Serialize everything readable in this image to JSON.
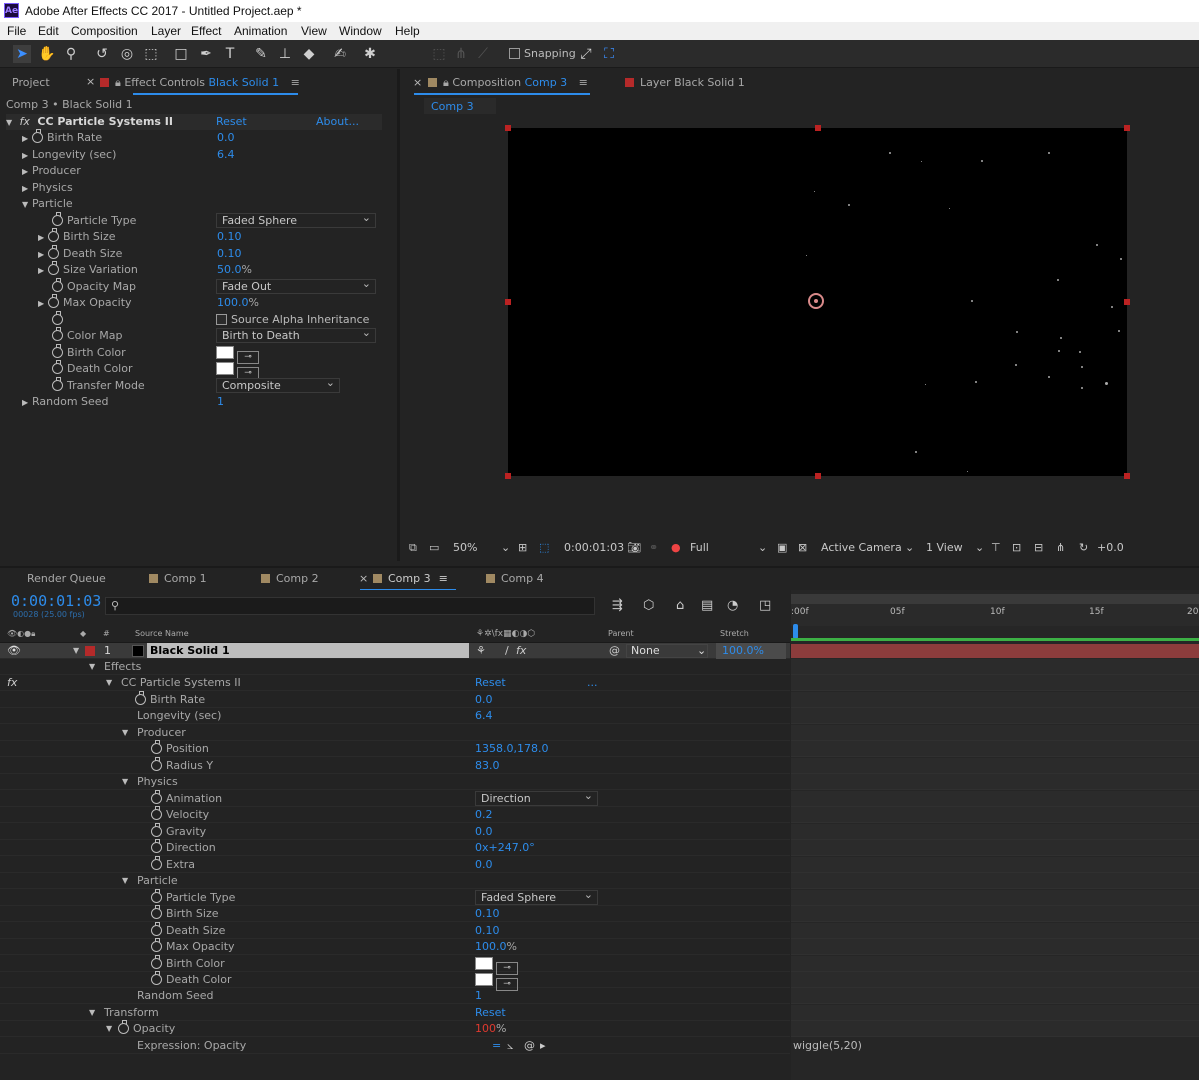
{
  "window": {
    "logo": "Ae",
    "title": "Adobe After Effects CC 2017 - Untitled Project.aep *"
  },
  "menu": [
    "File",
    "Edit",
    "Composition",
    "Layer",
    "Effect",
    "Animation",
    "View",
    "Window",
    "Help"
  ],
  "toolbar": {
    "snapping_label": "Snapping"
  },
  "left_panel": {
    "tab_project": "Project",
    "tab_effect_controls_prefix": "Effect Controls",
    "tab_effect_controls_layer": "Black Solid 1",
    "breadcrumb": "Comp 3 • Black Solid 1",
    "effect_name": "CC Particle Systems II",
    "reset": "Reset",
    "about": "About...",
    "props": {
      "birth_rate": {
        "label": "Birth Rate",
        "value": "0.0"
      },
      "longevity": {
        "label": "Longevity (sec)",
        "value": "6.4"
      },
      "producer": "Producer",
      "physics": "Physics",
      "particle": "Particle",
      "particle_type": {
        "label": "Particle Type",
        "value": "Faded Sphere"
      },
      "birth_size": {
        "label": "Birth Size",
        "value": "0.10"
      },
      "death_size": {
        "label": "Death Size",
        "value": "0.10"
      },
      "size_variation": {
        "label": "Size Variation",
        "value": "50.0",
        "unit": "%"
      },
      "opacity_map": {
        "label": "Opacity Map",
        "value": "Fade Out"
      },
      "max_opacity": {
        "label": "Max Opacity",
        "value": "100.0",
        "unit": "%"
      },
      "source_alpha": "Source Alpha Inheritance",
      "color_map": {
        "label": "Color Map",
        "value": "Birth to Death"
      },
      "birth_color": "Birth Color",
      "death_color": "Death Color",
      "transfer_mode": {
        "label": "Transfer Mode",
        "value": "Composite"
      },
      "random_seed": {
        "label": "Random Seed",
        "value": "1"
      }
    }
  },
  "viewer": {
    "tab_composition_prefix": "Composition",
    "tab_composition_name": "Comp 3",
    "tab_layer_prefix": "Layer",
    "tab_layer_name": "Black Solid 1",
    "comp_chip": "Comp 3",
    "zoom": "50%",
    "timecode": "0:00:01:03",
    "resolution": "Full",
    "camera": "Active Camera",
    "views": "1 View",
    "exposure": "+0.0",
    "brand_color": "#2d8ceb"
  },
  "timeline": {
    "tabs": [
      "Render Queue",
      "Comp 1",
      "Comp 2",
      "Comp 3",
      "Comp 4"
    ],
    "timecode": "0:00:01:03",
    "frame_info": "00028 (25.00 fps)",
    "col_source": "Source Name",
    "col_parent": "Parent",
    "col_stretch": "Stretch",
    "ruler": [
      ":00f",
      "05f",
      "10f",
      "15f",
      "20"
    ],
    "layer": {
      "index": "1",
      "name": "Black Solid 1",
      "parent": "None",
      "stretch": "100.0%"
    },
    "effects_label": "Effects",
    "fx_badge": "fx",
    "effect_name": "CC Particle Systems II",
    "reset": "Reset",
    "more": "...",
    "birth_rate": {
      "label": "Birth Rate",
      "value": "0.0"
    },
    "longevity": {
      "label": "Longevity (sec)",
      "value": "6.4"
    },
    "producer": "Producer",
    "position": {
      "label": "Position",
      "value": "1358.0,178.0"
    },
    "radius_y": {
      "label": "Radius Y",
      "value": "83.0"
    },
    "physics": "Physics",
    "animation": {
      "label": "Animation",
      "value": "Direction"
    },
    "velocity": {
      "label": "Velocity",
      "value": "0.2"
    },
    "gravity": {
      "label": "Gravity",
      "value": "0.0"
    },
    "direction": {
      "label": "Direction",
      "value": "0x+247.0°"
    },
    "extra": {
      "label": "Extra",
      "value": "0.0"
    },
    "particle": "Particle",
    "particle_type": {
      "label": "Particle Type",
      "value": "Faded Sphere"
    },
    "birth_size": {
      "label": "Birth Size",
      "value": "0.10"
    },
    "death_size": {
      "label": "Death Size",
      "value": "0.10"
    },
    "max_opacity": {
      "label": "Max Opacity",
      "value": "100.0",
      "unit": "%"
    },
    "birth_color": "Birth Color",
    "death_color": "Death Color",
    "random_seed": {
      "label": "Random Seed",
      "value": "1"
    },
    "transform": "Transform",
    "transform_reset": "Reset",
    "opacity": {
      "label": "Opacity",
      "value": "100",
      "unit": "%"
    },
    "expression_label": "Expression: Opacity",
    "expression_text": "wiggle(5,20)"
  }
}
